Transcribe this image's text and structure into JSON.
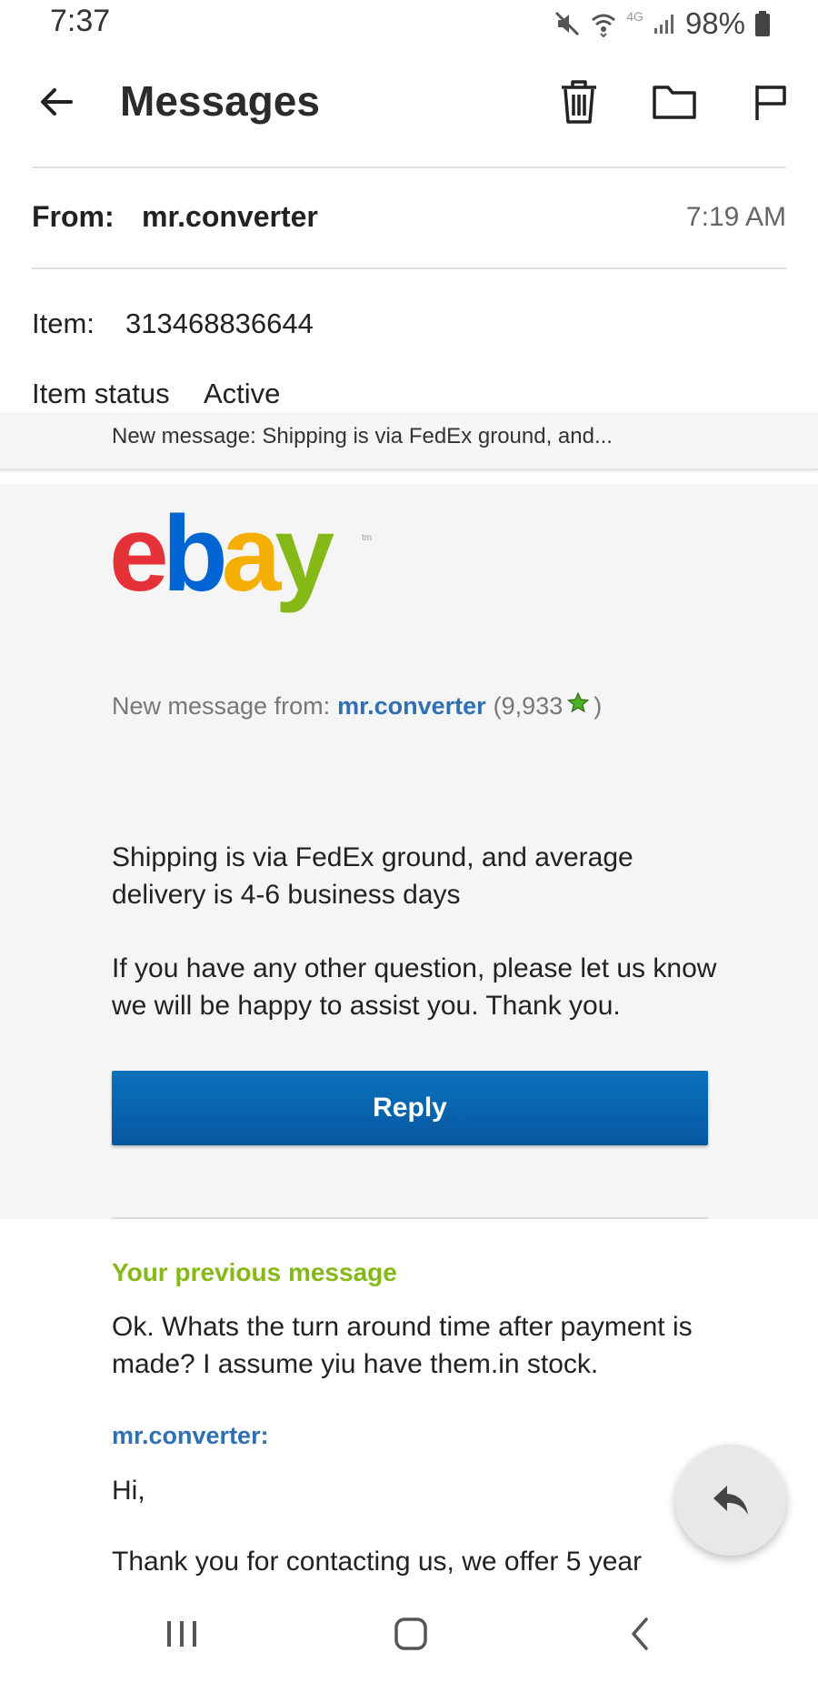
{
  "status_bar": {
    "time": "7:37",
    "network": "4G",
    "battery": "98%",
    "icons": [
      "mute-icon",
      "wifi-icon",
      "signal-icon",
      "battery-icon"
    ]
  },
  "header": {
    "title": "Messages",
    "actions": [
      "back-arrow-icon",
      "trash-icon",
      "folder-icon",
      "flag-icon"
    ]
  },
  "meta": {
    "from_label": "From:",
    "from_name": "mr.converter",
    "time": "7:19 AM",
    "item_label": "Item:",
    "item_value": "313468836644",
    "status_label": "Item status",
    "status_value": "Active"
  },
  "preview": {
    "text": "New message: Shipping is via FedEx ground, and..."
  },
  "email": {
    "logo_text": {
      "e": "e",
      "b": "b",
      "a": "a",
      "y": "y"
    },
    "logo_tm": "tm",
    "new_message_prefix": "New message from:",
    "sender": "mr.converter",
    "rating_open": "(9,933",
    "rating_close": ")",
    "paragraph1": "Shipping is via FedEx ground, and average delivery is 4-6 business days",
    "paragraph2": "If you have any other question, please let us know we will be happy to assist you. Thank you.",
    "reply_label": "Reply",
    "previous_heading": "Your previous message",
    "previous_body": "Ok. Whats the turn around time after payment is made? I assume yiu have them.in stock.",
    "sender_label": "mr.converter:",
    "greeting": "Hi,",
    "cut_line": "Thank you for contacting us, we offer 5 year"
  },
  "colors": {
    "link_blue": "#2f6fb3",
    "reply_blue": "#0a72bd",
    "previous_green": "#86b817",
    "star_green": "#4caf2a"
  },
  "nav": [
    "recents-icon",
    "home-icon",
    "back-icon"
  ]
}
